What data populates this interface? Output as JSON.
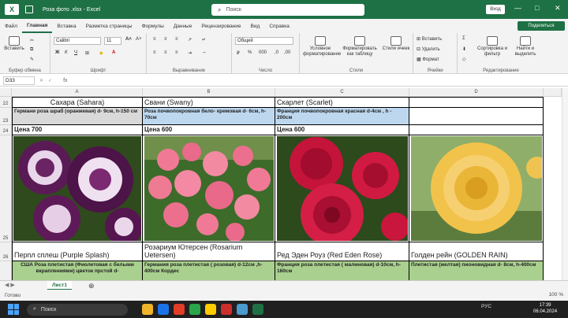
{
  "window": {
    "title": "Роза фото .xlsx  -  Excel",
    "search_placeholder": "Поиск",
    "signin": "Вход"
  },
  "tabs": [
    "Файл",
    "Главная",
    "Вставка",
    "Разметка страницы",
    "Формулы",
    "Данные",
    "Рецензирование",
    "Вид",
    "Справка"
  ],
  "share_label": "Поделиться",
  "ribbon": {
    "paste": "Вставить",
    "clipboard": "Буфер обмена",
    "font_name": "Calibri",
    "font_size": "11",
    "font_group": "Шрифт",
    "align_group": "Выравнивание",
    "number_format": "Общий",
    "number_group": "Число",
    "cond_format": "Условное форматирование",
    "format_table": "Форматировать как таблицу",
    "cell_styles": "Стили ячеек",
    "styles_group": "Стили",
    "insert": "Вставить",
    "delete": "Удалить",
    "format": "Формат",
    "cells_group": "Ячейки",
    "sort_filter": "Сортировка и фильтр",
    "find_select": "Найти и выделить",
    "editing_group": "Редактирование"
  },
  "formula_bar": {
    "namebox": "D33",
    "fx": "fx",
    "value": ""
  },
  "columns": [
    "A",
    "B",
    "C",
    "D"
  ],
  "rows": [
    "22",
    "23",
    "24",
    "25",
    "26"
  ],
  "cells": {
    "A22": "Сахара (Sahara)",
    "B22": "Свани (Swany)",
    "C22": "Скарлет (Scarlet)",
    "A23": "Германи роза шраб (оранжевая) d- 9см, h-150 см",
    "B23": "Роза почвопокровная бело- кремовая d- 6см, h-70см",
    "C23": "Франция почвопокровная красная d-4см , h - 200см",
    "A24": "Цена 700",
    "B24": "Цена 600",
    "C24": "Цена 600",
    "A26": "Перпл сплеш (Purple Splash)",
    "B26": "Розариум Ютерсен (Rosarium Uetersen)",
    "C26": "Ред Эден Роуз (Red Eden Rose)",
    "D26": "Голден рейн (GOLDEN RAIN)",
    "A27": "США Роза плетистая (Фиолетовая с белыми вкраплениями) цветок прстой d-",
    "B27": "Германия роза плетистая ( розовая) d-12см ,h- 400см Кордес",
    "C27": "Франция роза плетистая ( малиновая) d-10см, h-160см",
    "D27": "Плетистая (желтая) пионовидная d- 8см, h-400см"
  },
  "colors": {
    "accent": "#1e7145",
    "gray_fill": "#d9d9d9",
    "blue_fill": "#bdd7ee",
    "green_fill": "#a9d08e"
  },
  "sheet_tab": "Лист1",
  "status": {
    "ready": "Готово",
    "zoom": "100 %"
  },
  "taskbar": {
    "search": "Поиск",
    "lang": "РУС",
    "time": "17:39",
    "date": "06.04.2024"
  }
}
